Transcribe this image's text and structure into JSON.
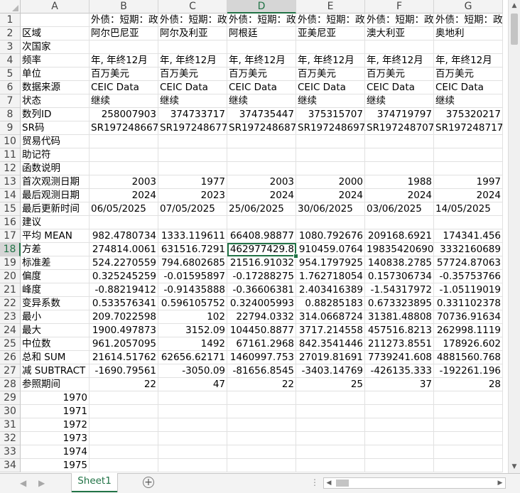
{
  "sheet": {
    "columns": [
      "A",
      "B",
      "C",
      "D",
      "E",
      "F",
      "G"
    ],
    "active_col": "D",
    "active_row": 18,
    "row_numbers": [
      "1",
      "2",
      "3",
      "4",
      "5",
      "6",
      "7",
      "8",
      "9",
      "10",
      "11",
      "12",
      "13",
      "14",
      "15",
      "16",
      "17",
      "18",
      "19",
      "20",
      "21",
      "22",
      "23",
      "24",
      "25",
      "26",
      "27",
      "28",
      "29",
      "30",
      "31",
      "32",
      "33",
      "34"
    ],
    "rows": [
      [
        "",
        "外债：短期：政府",
        "外债：短期：政府",
        "外债：短期：政府",
        "外债：短期：政府",
        "外债：短期：政府",
        "外债：短期：政府"
      ],
      [
        "区域",
        "阿尔巴尼亚",
        "阿尔及利亚",
        "阿根廷",
        "亚美尼亚",
        "澳大利亚",
        "奥地利"
      ],
      [
        "次国家",
        "",
        "",
        "",
        "",
        "",
        ""
      ],
      [
        "频率",
        "年, 年终12月",
        "年, 年终12月",
        "年, 年终12月",
        "年, 年终12月",
        "年, 年终12月",
        "年, 年终12月"
      ],
      [
        "单位",
        "百万美元",
        "百万美元",
        "百万美元",
        "百万美元",
        "百万美元",
        "百万美元"
      ],
      [
        "数据来源",
        "CEIC Data",
        "CEIC Data",
        "CEIC Data",
        "CEIC Data",
        "CEIC Data",
        "CEIC Data"
      ],
      [
        "状态",
        "继续",
        "继续",
        "继续",
        "继续",
        "继续",
        "继续"
      ],
      [
        "数列ID",
        "258007903",
        "374733717",
        "374735447",
        "375315707",
        "374719797",
        "375320217"
      ],
      [
        "SR码",
        "SR197248667",
        "SR197248677",
        "SR197248687",
        "SR197248697",
        "SR197248707",
        "SR197248717"
      ],
      [
        "贸易代码",
        "",
        "",
        "",
        "",
        "",
        ""
      ],
      [
        "助记符",
        "",
        "",
        "",
        "",
        "",
        ""
      ],
      [
        "函数说明",
        "",
        "",
        "",
        "",
        "",
        ""
      ],
      [
        "首次观测日期",
        "2003",
        "1977",
        "2003",
        "2000",
        "1988",
        "1997"
      ],
      [
        "最后观测日期",
        "2024",
        "2023",
        "2024",
        "2024",
        "2024",
        "2024"
      ],
      [
        "最后更新时间",
        "06/05/2025",
        "07/05/2025",
        "25/06/2025",
        "30/06/2025",
        "03/06/2025",
        "14/05/2025"
      ],
      [
        "建议",
        "",
        "",
        "",
        "",
        "",
        ""
      ],
      [
        "平均 MEAN",
        "982.4780734",
        "1333.119611",
        "66408.98877",
        "1080.792676",
        "209168.6921",
        "174341.456"
      ],
      [
        "方差",
        "274814.0061",
        "631516.7291",
        "462977429.8",
        "910459.0764",
        "19835420690",
        "3332160689"
      ],
      [
        "标准差",
        "524.2270559",
        "794.6802685",
        "21516.91032",
        "954.1797925",
        "140838.2785",
        "57724.87063"
      ],
      [
        "偏度",
        "0.325245259",
        "-0.01595897",
        "-0.17288275",
        "1.762718054",
        "0.157306734",
        "-0.35753766"
      ],
      [
        "峰度",
        "-0.88219412",
        "-0.91435888",
        "-0.36606381",
        "2.403416389",
        "-1.54317972",
        "-1.05119019"
      ],
      [
        "变异系数",
        "0.533576341",
        "0.596105752",
        "0.324005993",
        "0.88285183",
        "0.673323895",
        "0.331102378"
      ],
      [
        "最小",
        "209.7022598",
        "102",
        "22794.0332",
        "314.0668724",
        "31381.48808",
        "70736.91634"
      ],
      [
        "最大",
        "1900.497873",
        "3152.09",
        "104450.8877",
        "3717.214558",
        "457516.8213",
        "262998.1119"
      ],
      [
        "中位数",
        "961.2057095",
        "1492",
        "67161.2968",
        "842.3541446",
        "211273.8551",
        "178926.602"
      ],
      [
        "总和 SUM",
        "21614.51762",
        "62656.62171",
        "1460997.753",
        "27019.81691",
        "7739241.608",
        "4881560.768"
      ],
      [
        "减 SUBTRACT",
        "-1690.79561",
        "-3050.09",
        "-81656.8545",
        "-3403.14769",
        "-426135.333",
        "-192261.196"
      ],
      [
        "参照期间",
        "22",
        "47",
        "22",
        "25",
        "37",
        "28"
      ],
      [
        "1970",
        "",
        "",
        "",
        "",
        "",
        ""
      ],
      [
        "1971",
        "",
        "",
        "",
        "",
        "",
        ""
      ],
      [
        "1972",
        "",
        "",
        "",
        "",
        "",
        ""
      ],
      [
        "1973",
        "",
        "",
        "",
        "",
        "",
        ""
      ],
      [
        "1974",
        "",
        "",
        "",
        "",
        "",
        ""
      ],
      [
        "1975",
        "",
        "",
        "",
        "",
        "",
        ""
      ]
    ]
  },
  "tabs": {
    "active_sheet": "Sheet1",
    "add_sheet_icon": "plus-icon"
  },
  "icons": {
    "scroll_up": "▲",
    "scroll_down": "▼",
    "scroll_left": "◀",
    "scroll_right": "▶",
    "tab_prev": "◀",
    "tab_next": "▶",
    "add": "+",
    "more": "⋮"
  },
  "colors": {
    "accent": "#217346",
    "header_bg": "#f3f3f3",
    "grid": "#e1e1e1"
  }
}
